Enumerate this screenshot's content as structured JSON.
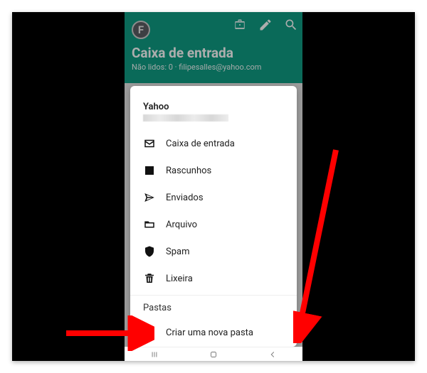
{
  "appbar": {
    "title": "Caixa de entrada",
    "unread_label": "Não lidos: 0",
    "email": "filipesalles@yahoo.com",
    "avatar_letter": "F"
  },
  "sheet": {
    "account_name": "Yahoo",
    "items": [
      {
        "label": "Caixa de entrada"
      },
      {
        "label": "Rascunhos"
      },
      {
        "label": "Enviados"
      },
      {
        "label": "Arquivo"
      },
      {
        "label": "Spam"
      },
      {
        "label": "Lixeira"
      }
    ],
    "section_label": "Pastas",
    "add_label": "Criar uma nova pasta"
  }
}
